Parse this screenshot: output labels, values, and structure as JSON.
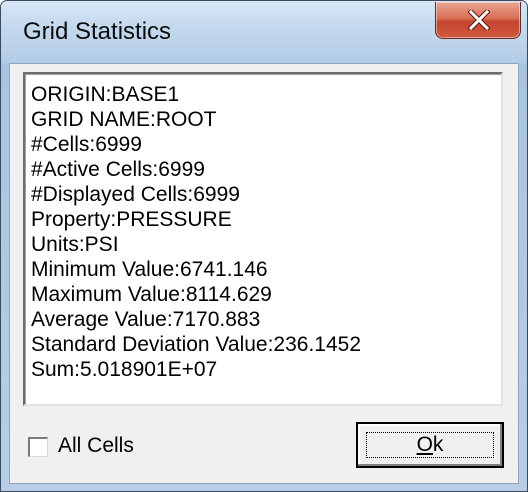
{
  "window": {
    "title": "Grid Statistics",
    "close_icon": "close-x-icon"
  },
  "info": {
    "lines": [
      "ORIGIN:BASE1",
      "GRID NAME:ROOT",
      "#Cells:6999",
      "#Active Cells:6999",
      "#Displayed Cells:6999",
      "Property:PRESSURE",
      "Units:PSI",
      "Minimum Value:6741.146",
      "Maximum Value:8114.629",
      "Average Value:7170.883",
      "Standard Deviation Value:236.1452",
      "Sum:5.018901E+07"
    ]
  },
  "all_cells": {
    "label": "All Cells",
    "checked": false
  },
  "ok_button": {
    "mnemonic": "O",
    "rest": "k"
  },
  "colors": {
    "close_button": "#c4452d",
    "title_bar": "#c3d8ed",
    "dialog_face": "#f0f0f0"
  }
}
